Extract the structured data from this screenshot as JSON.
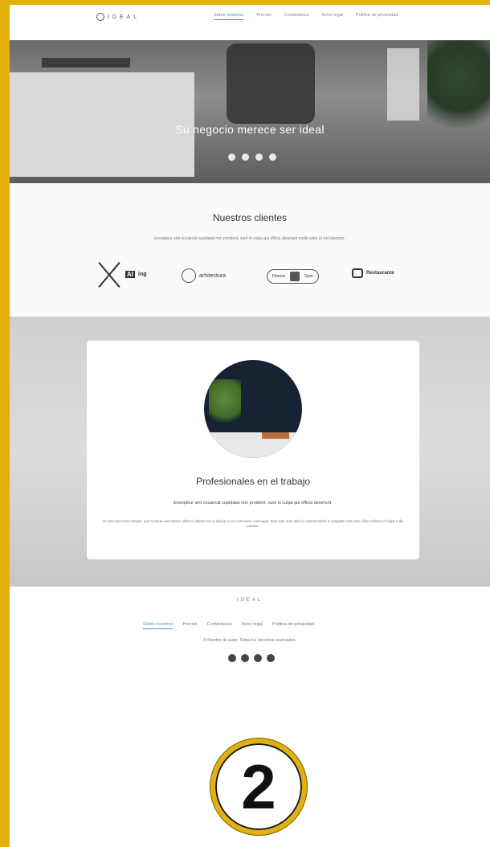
{
  "colors": {
    "frame": "#e2b10d",
    "accent": "#3a9ab0"
  },
  "nav": {
    "logo_text": "IDEAL",
    "links": [
      "Sobre nosotros",
      "Precios",
      "Contáctanos",
      "Aviso legal",
      "Política de privacidad"
    ]
  },
  "hero": {
    "title": "Su negocio merece ser ideal",
    "social_icons": [
      "facebook-icon",
      "instagram-icon",
      "twitter-icon",
      "pinterest-icon"
    ]
  },
  "clients": {
    "title": "Nuestros clientes",
    "subtitle": "Excepteur sint occaecat cupidatat non proident, sunt in culpa qui officia deserunt mollit anim id est laborum.",
    "logos": [
      "AI",
      "ing",
      "arhitectura",
      "Fitness",
      "Gym",
      "Restaurante"
    ]
  },
  "pro": {
    "title": "Profesionales en el trabajo",
    "subtitle": "Excepteur sint occaecat cupidatat non proident, sunt in culpa qui officia deserunt.",
    "body": "Ut enim ad minim veniam, quis nostrud exercitation ullamco laboris nisi ut aliquip ex ea commodo consequat. Duis aute irure dolor in reprehenderit in voluptate velit esse cillum dolore eu fugiat nulla pariatur."
  },
  "footer": {
    "logo_text": "IDEAL",
    "links": [
      "Sobre nosotros",
      "Precios",
      "Contáctanos",
      "Aviso legal",
      "Política de privacidad"
    ],
    "copyright": "© Nombre de autor. Todos los derechos reservados.",
    "social_icons": [
      "facebook-icon",
      "instagram-icon",
      "twitter-icon",
      "pinterest-icon"
    ]
  },
  "step": {
    "number": "2"
  }
}
